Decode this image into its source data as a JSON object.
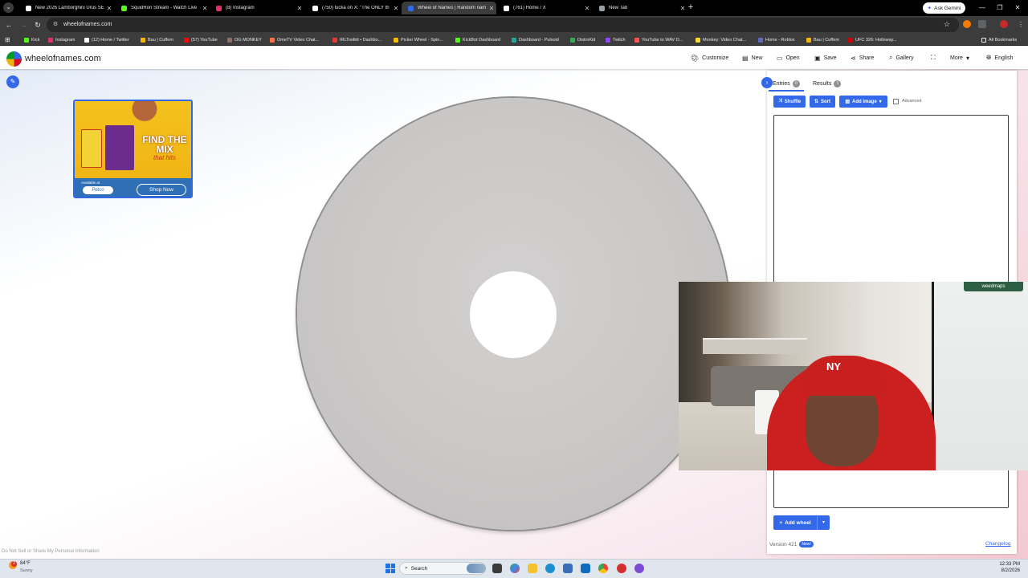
{
  "browser": {
    "tabs": [
      {
        "title": "New 2026 Lamborghini Urus SE",
        "active": false,
        "color": "#ffffff"
      },
      {
        "title": "SquidRon Stream - Watch Live",
        "active": false,
        "color": "#53fc18"
      },
      {
        "title": "(8) Instagram",
        "active": false,
        "color": "#e1306c"
      },
      {
        "title": "(750) lucka on X: \"The ONLY th",
        "active": false,
        "color": "#ffffff"
      },
      {
        "title": "Wheel of Names | Random nam",
        "active": true,
        "color": "#3369e8"
      },
      {
        "title": "(761) Home / X",
        "active": false,
        "color": "#ffffff"
      },
      {
        "title": "New Tab",
        "active": false,
        "color": "#9aa0a6"
      }
    ],
    "new_tab": "+",
    "gemini_label": "Ask Gemini",
    "url": "wheelofnames.com",
    "bookmarks": [
      {
        "label": "Kick",
        "color": "#53fc18"
      },
      {
        "label": "Instagram",
        "color": "#e1306c"
      },
      {
        "label": "(12) Home / Twitter",
        "color": "#ffffff"
      },
      {
        "label": "Bau | Cuffem",
        "color": "#f4b400"
      },
      {
        "label": "(57) YouTube",
        "color": "#ff0000"
      },
      {
        "label": "OG MONKEY",
        "color": "#8d6e63"
      },
      {
        "label": "OmeTV Video Chat...",
        "color": "#ff7043"
      },
      {
        "label": "IRLToolkit • Dashbo...",
        "color": "#e53935"
      },
      {
        "label": "Picker Wheel - Spin...",
        "color": "#fbbc04"
      },
      {
        "label": "KickBot Dashboard",
        "color": "#53fc18"
      },
      {
        "label": "Dashboard - Pulsoid",
        "color": "#26a69a"
      },
      {
        "label": "DistroKid",
        "color": "#34a853"
      },
      {
        "label": "Twitch",
        "color": "#9146ff"
      },
      {
        "label": "YouTube to WAV D...",
        "color": "#ff5252"
      },
      {
        "label": "Monkey: Video Chat...",
        "color": "#fdd835"
      },
      {
        "label": "Home - Roblox",
        "color": "#5c6bc0"
      },
      {
        "label": "Bau | Cuffem",
        "color": "#f4b400"
      },
      {
        "label": "UFC 326: Holloway...",
        "color": "#d50000"
      }
    ],
    "all_bookmarks": "All Bookmarks"
  },
  "site": {
    "brand": "wheelofnames.com",
    "nav": {
      "customize": "Customize",
      "new": "New",
      "open": "Open",
      "save": "Save",
      "share": "Share",
      "gallery": "Gallery",
      "more": "More",
      "language": "English"
    },
    "ad": {
      "headline": "FIND THE MIX",
      "subline": "that hits",
      "available": "Available at",
      "retailer": "Petco",
      "cta": "Shop Now"
    },
    "panel": {
      "entries_label": "Entries",
      "entries_count": "0",
      "results_label": "Results",
      "results_count": "1",
      "shuffle": "Shuffle",
      "sort": "Sort",
      "add_image": "Add image",
      "advanced": "Advanced",
      "add_wheel": "Add wheel",
      "version": "Version 421",
      "new_badge": "New!",
      "changelog": "Changelog"
    },
    "footer_link": "Do Not Sell or Share My Personal Information",
    "accent": "#3369e8"
  },
  "webcam": {
    "brand_tag": "weedmaps"
  },
  "taskbar": {
    "weather_temp": "84°F",
    "weather_cond": "Sunny",
    "weather_badge": "2",
    "search": "Search",
    "time": "12:33 PM",
    "date": "8/2/2026"
  }
}
